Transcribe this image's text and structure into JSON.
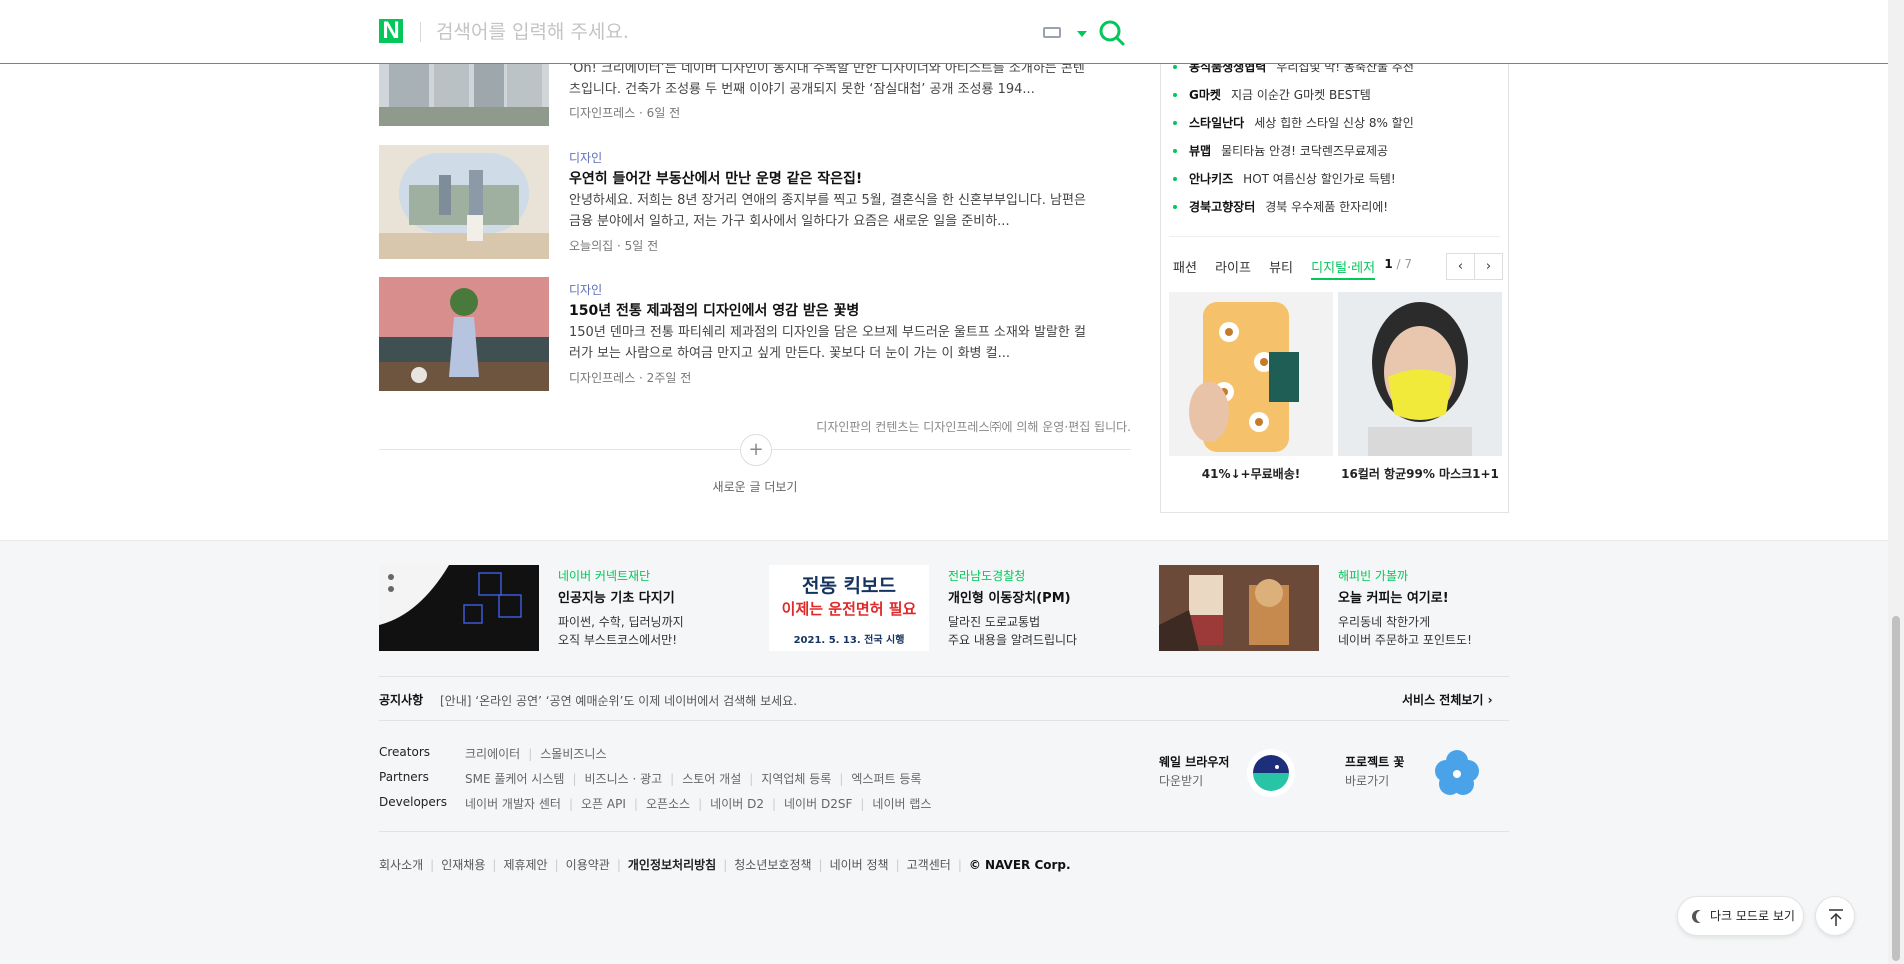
{
  "header": {
    "logo": "N",
    "search_placeholder": "검색어를 입력해 주세요."
  },
  "articles": [
    {
      "category": "",
      "title": "",
      "desc": "‘Oh! 크리에이터’는 네이버 디자인이 동시대 주목할 만한 디자이너와 아티스트를 소개하는 콘텐츠입니다. 건축가 조성룡 두 번째 이야기 공개되지 못한 ‘잠실대첩’ 공개 조성룡 194...",
      "meta": "디자인프레스 · 6일 전"
    },
    {
      "category": "디자인",
      "title": "우연히 들어간 부동산에서 만난 운명 같은 작은집!",
      "desc": "안녕하세요. 저희는 8년 장거리 연애의 종지부를 찍고 5월, 결혼식을 한 신혼부부입니다. 남편은 금융 분야에서 일하고, 저는 가구 회사에서 일하다가 요즘은 새로운 일을 준비하...",
      "meta": "오늘의집 · 5일 전"
    },
    {
      "category": "디자인",
      "title": "150년 전통 제과점의 디자인에서 영감 받은 꽃병",
      "desc": "150년 덴마크 전통 파티쉐리 제과점의 디자인을 담은 오브제 부드러운 울트프 소재와 발랄한 컬러가 보는 사람으로 하여금 만지고 싶게 만든다. 꽃보다 더 눈이 가는 이 화병 컬...",
      "meta": "디자인프레스 · 2주일 전"
    }
  ],
  "design_notice": "디자인판의 컨텐츠는 디자인프레스㈜에 의해 운영·편집 됩니다.",
  "more": {
    "plus": "+",
    "label": "새로운 글 더보기"
  },
  "shopping": {
    "rows": [
      {
        "brand": "농식품생생협력",
        "text": "우리집빛 막! 농축산물 추천"
      },
      {
        "brand": "G마켓",
        "text": "지금 이순간 G마켓 BEST템"
      },
      {
        "brand": "스타일난다",
        "text": "세상 힙한 스타일 신상 8% 할인"
      },
      {
        "brand": "뷰맵",
        "text": "물티타늄 안경! 코닥렌즈무료제공"
      },
      {
        "brand": "안나키즈",
        "text": "HOT 여름신상 할인가로 득템!"
      },
      {
        "brand": "경북고향장터",
        "text": "경북 우수제품 한자리에!"
      }
    ],
    "tabs": [
      "패션",
      "라이프",
      "뷰티",
      "디지털·레저"
    ],
    "active_tab": "디지털·레저",
    "page_current": "1",
    "page_total": "/ 7",
    "prev": "‹",
    "next": "›",
    "products": [
      {
        "label": "41%↓+무료배송!"
      },
      {
        "label": "16컬러 항균99% 마스크1+1"
      }
    ]
  },
  "promos": [
    {
      "source": "네이버 커넥트재단",
      "title": "인공지능 기초 다지기",
      "desc": "파이썬, 수학, 딥러닝까지\n오직 부스트코스에서만!"
    },
    {
      "source": "전라남도경찰청",
      "title": "개인형 이동장치(PM)",
      "desc": "달라진 도로교통법\n주요 내용을 알려드립니다",
      "img_line1": "전동 킥보드",
      "img_line2": "이제는 운전면허 필요",
      "img_line3": "2021. 5. 13. 전국 시행"
    },
    {
      "source": "해피빈 가볼까",
      "title": "오늘 커피는 여기로!",
      "desc": "우리동네 착한가게\n네이버 주문하고 포인트도!"
    }
  ],
  "notice": {
    "heading": "공지사항",
    "text": "[안내] ‘온라인 공연’ ‘공연 예매순위’도 이제 네이버에서 검색해 보세요.",
    "service_all": "서비스 전체보기"
  },
  "link_groups": [
    {
      "head": "Creators",
      "items": [
        "크리에이터",
        "스몰비즈니스"
      ]
    },
    {
      "head": "Partners",
      "items": [
        "SME 풀케어 시스템",
        "비즈니스 · 광고",
        "스토어 개설",
        "지역업체 등록",
        "엑스퍼트 등록"
      ]
    },
    {
      "head": "Developers",
      "items": [
        "네이버 개발자 센터",
        "오픈 API",
        "오픈소스",
        "네이버 D2",
        "네이버 D2SF",
        "네이버 랩스"
      ]
    }
  ],
  "apps": [
    {
      "name": "웨일 브라우저",
      "sub": "다운받기"
    },
    {
      "name": "프로젝트 꽃",
      "sub": "바로가기"
    }
  ],
  "footer": {
    "links": [
      "회사소개",
      "인재채용",
      "제휴제안",
      "이용약관",
      "개인정보처리방침",
      "청소년보호정책",
      "네이버 정책",
      "고객센터"
    ],
    "copyright": "© NAVER Corp."
  },
  "floating": {
    "dark_mode": "다크 모드로 보기"
  },
  "colors": {
    "accent": "#03c75a",
    "category": "#5f6fb8"
  }
}
